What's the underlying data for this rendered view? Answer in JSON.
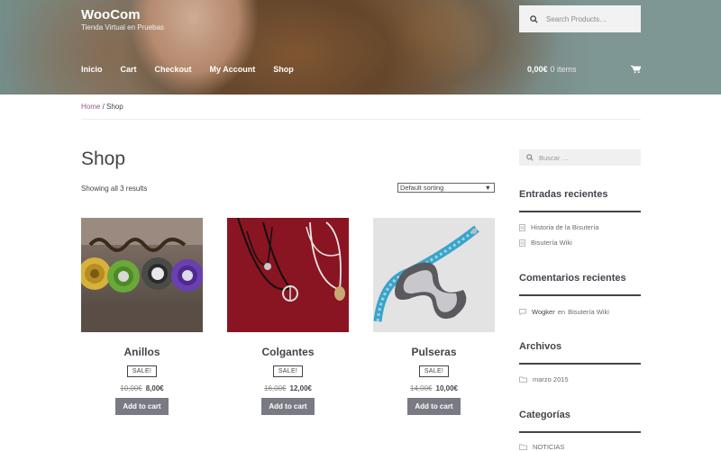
{
  "header": {
    "site_title": "WooCom",
    "site_description": "Tienda Virtual en Pruebas",
    "search_placeholder": "Search Products…",
    "nav": [
      "Inicio",
      "Cart",
      "Checkout",
      "My Account",
      "Shop"
    ],
    "cart_amount": "0,00€",
    "cart_items": "0 items"
  },
  "breadcrumb": {
    "home": "Home",
    "separator": " / ",
    "current": "Shop"
  },
  "main": {
    "title": "Shop",
    "result_count": "Showing all 3 results",
    "sorting": "Default sorting"
  },
  "products": [
    {
      "name": "Anillos",
      "sale": "SALE!",
      "old_price": "10,00€",
      "price": "8,00€",
      "button": "Add to cart"
    },
    {
      "name": "Colgantes",
      "sale": "SALE!",
      "old_price": "16,00€",
      "price": "12,00€",
      "button": "Add to cart"
    },
    {
      "name": "Pulseras",
      "sale": "SALE!",
      "old_price": "14,00€",
      "price": "10,00€",
      "button": "Add to cart"
    }
  ],
  "sidebar": {
    "search_placeholder": "Buscar …",
    "recent_posts_title": "Entradas recientes",
    "recent_posts": [
      "Historia de la Bisutería",
      "Bisutería Wiki"
    ],
    "recent_comments_title": "Comentarios recientes",
    "comment_author": "Wogker",
    "comment_on": "en",
    "comment_post": "Bisutería Wiki",
    "archives_title": "Archivos",
    "archive_month": "marzo 2015",
    "categories_title": "Categorías",
    "category": "NOTICIAS"
  },
  "colors": {
    "accent": "#96588a",
    "button": "#7a7a84",
    "text": "#43454b"
  }
}
